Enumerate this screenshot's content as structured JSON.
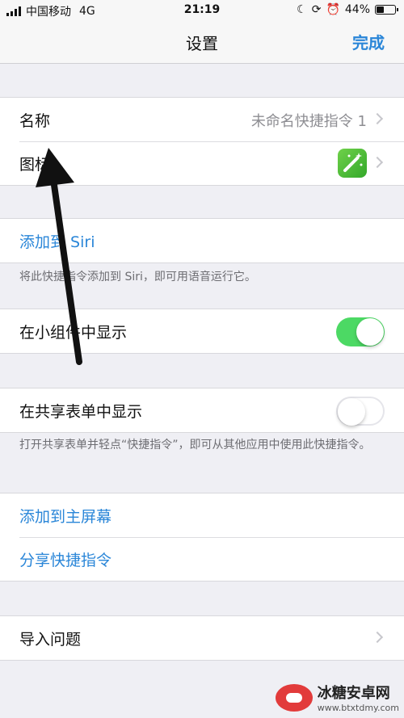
{
  "status": {
    "carrier": "中国移动",
    "network": "4G",
    "time": "21:19",
    "battery": "44%",
    "battery_level": 0.44
  },
  "nav": {
    "title": "设置",
    "done": "完成"
  },
  "group1": {
    "name_label": "名称",
    "name_value": "未命名快捷指令 1",
    "icon_label": "图标"
  },
  "siri": {
    "add_label": "添加到 Siri",
    "footnote": "将此快捷指令添加到 Siri，即可用语音运行它。"
  },
  "widget": {
    "label": "在小组件中显示",
    "on": true
  },
  "share": {
    "label": "在共享表单中显示",
    "on": false,
    "footnote": "打开共享表单并轻点“快捷指令”，即可从其他应用中使用此快捷指令。"
  },
  "actions": {
    "home_screen": "添加到主屏幕",
    "share_shortcut": "分享快捷指令"
  },
  "import": {
    "label": "导入问题"
  },
  "watermark": {
    "title": "冰糖安卓网",
    "url": "www.btxtdmy.com"
  },
  "colors": {
    "accent": "#2a86d8",
    "toggle_on": "#4cd964"
  },
  "icons": [
    "signal-icon",
    "moon-icon",
    "lock-rotation-icon",
    "alarm-icon",
    "battery-icon",
    "chevron-right-icon",
    "magic-wand-icon"
  ]
}
